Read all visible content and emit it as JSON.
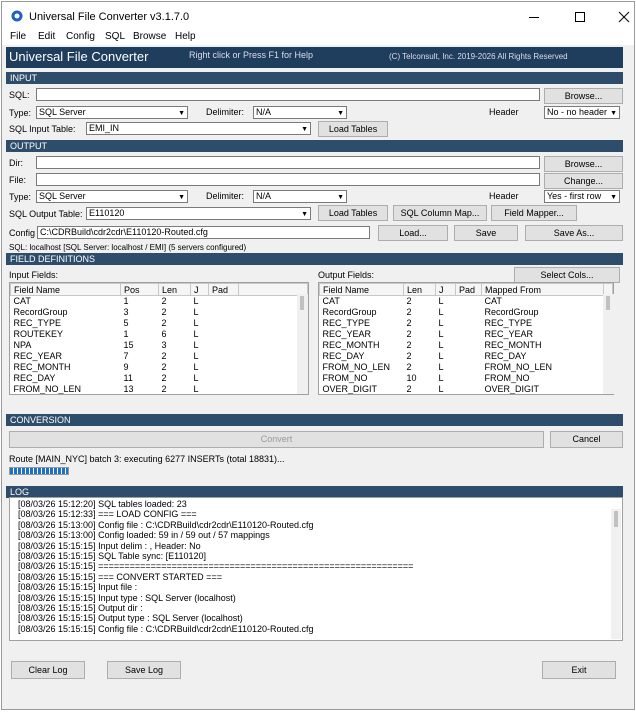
{
  "window": {
    "title": "Universal File Converter  v3.1.7.0"
  },
  "menu": [
    "File",
    "Edit",
    "Config",
    "SQL",
    "Browse",
    "Help"
  ],
  "banner": {
    "app_name": "Universal File Converter",
    "help_hint": "Right click or Press F1 for Help",
    "copyright": "(C) Telconsult, Inc.  2019-2026  All Rights Reserved"
  },
  "input": {
    "section": "INPUT",
    "sql_label": "SQL:",
    "sql_value": "",
    "browse": "Browse...",
    "type_label": "Type:",
    "type_value": "SQL Server",
    "delim_label": "Delimiter:",
    "delim_value": "N/A",
    "header_label": "Header",
    "header_value": "No - no header",
    "table_label": "SQL Input Table:",
    "table_value": "EMI_IN",
    "load_tables": "Load Tables"
  },
  "output": {
    "section": "OUTPUT",
    "dir_label": "Dir:",
    "dir_value": "",
    "browse": "Browse...",
    "file_label": "File:",
    "file_value": "",
    "change": "Change...",
    "type_label": "Type:",
    "type_value": "SQL Server",
    "delim_label": "Delimiter:",
    "delim_value": "N/A",
    "header_label": "Header",
    "header_value": "Yes - first row",
    "table_label": "SQL Output Table:",
    "table_value": "E110120",
    "load_tables": "Load Tables",
    "sql_column_map": "SQL Column Map...",
    "field_mapper": "Field Mapper..."
  },
  "config": {
    "label": "Config",
    "value": "C:\\CDRBuild\\cdr2cdr\\E110120-Routed.cfg",
    "load": "Load...",
    "save": "Save",
    "save_as": "Save As...",
    "sql_status": "SQL: localhost  [SQL Server: localhost / EMI]  (5 servers configured)"
  },
  "fields": {
    "section": "FIELD DEFINITIONS",
    "input_label": "Input Fields:",
    "output_label": "Output Fields:",
    "select_cols": "Select Cols...",
    "input_columns": [
      "Field Name",
      "Pos",
      "Len",
      "J",
      "Pad"
    ],
    "input_rows": [
      [
        "CAT",
        "1",
        "2",
        "L",
        ""
      ],
      [
        "RecordGroup",
        "3",
        "2",
        "L",
        ""
      ],
      [
        "REC_TYPE",
        "5",
        "2",
        "L",
        ""
      ],
      [
        "ROUTEKEY",
        "1",
        "6",
        "L",
        ""
      ],
      [
        "NPA",
        "15",
        "3",
        "L",
        ""
      ],
      [
        "REC_YEAR",
        "7",
        "2",
        "L",
        ""
      ],
      [
        "REC_MONTH",
        "9",
        "2",
        "L",
        ""
      ],
      [
        "REC_DAY",
        "11",
        "2",
        "L",
        ""
      ],
      [
        "FROM_NO_LEN",
        "13",
        "2",
        "L",
        ""
      ]
    ],
    "output_columns": [
      "Field Name",
      "Len",
      "J",
      "Pad",
      "Mapped From"
    ],
    "output_rows": [
      [
        "CAT",
        "2",
        "L",
        "",
        "CAT"
      ],
      [
        "RecordGroup",
        "2",
        "L",
        "",
        "RecordGroup"
      ],
      [
        "REC_TYPE",
        "2",
        "L",
        "",
        "REC_TYPE"
      ],
      [
        "REC_YEAR",
        "2",
        "L",
        "",
        "REC_YEAR"
      ],
      [
        "REC_MONTH",
        "2",
        "L",
        "",
        "REC_MONTH"
      ],
      [
        "REC_DAY",
        "2",
        "L",
        "",
        "REC_DAY"
      ],
      [
        "FROM_NO_LEN",
        "2",
        "L",
        "",
        "FROM_NO_LEN"
      ],
      [
        "FROM_NO",
        "10",
        "L",
        "",
        "FROM_NO"
      ],
      [
        "OVER_DIGIT",
        "2",
        "L",
        "",
        "OVER_DIGIT"
      ]
    ]
  },
  "conversion": {
    "section": "CONVERSION",
    "convert": "Convert",
    "cancel": "Cancel",
    "status": "Route [MAIN_NYC] batch 3: executing 6277 INSERTs (total 18831)...",
    "progress": 0.14
  },
  "log": {
    "section": "LOG",
    "lines": [
      "[08/03/26 15:12:20] SQL tables loaded: 23",
      "[08/03/26 15:12:33] === LOAD CONFIG ===",
      "[08/03/26 15:13:00] Config file : C:\\CDRBuild\\cdr2cdr\\E110120-Routed.cfg",
      "[08/03/26 15:13:00] Config loaded: 59 in / 59 out / 57 mappings",
      "[08/03/26 15:15:15] Input delim : ,  Header: No",
      "[08/03/26 15:15:15] SQL Table sync: [E110120]",
      "[08/03/26 15:15:15] ============================================================",
      "[08/03/26 15:15:15] === CONVERT STARTED ===",
      "[08/03/26 15:15:15] Input file  :",
      "[08/03/26 15:15:15] Input type  : SQL Server (localhost)",
      "[08/03/26 15:15:15] Output dir  :",
      "[08/03/26 15:15:15] Output type : SQL Server (localhost)",
      "[08/03/26 15:15:15] Config file : C:\\CDRBuild\\cdr2cdr\\E110120-Routed.cfg"
    ]
  },
  "footer": {
    "clear_log": "Clear Log",
    "save_log": "Save Log",
    "exit": "Exit"
  }
}
